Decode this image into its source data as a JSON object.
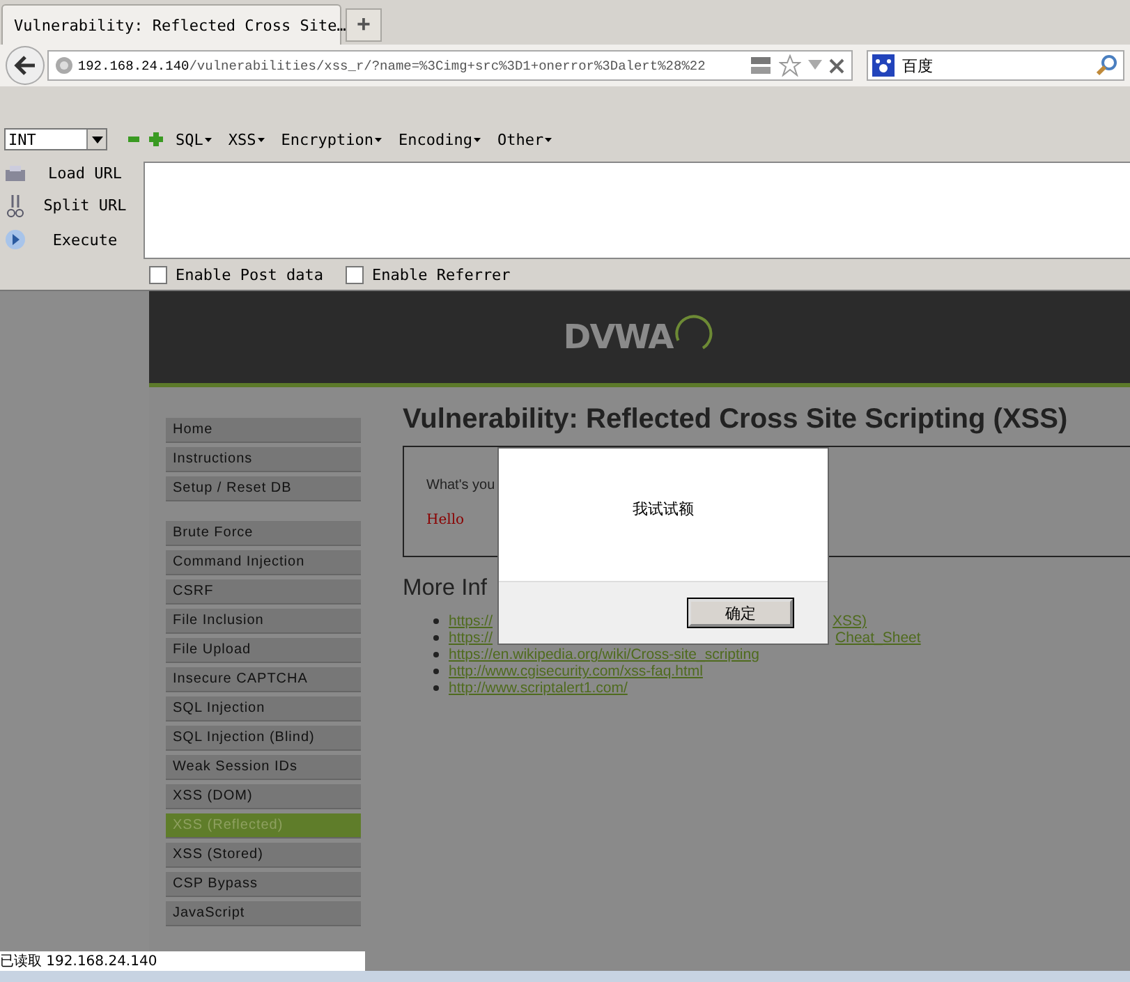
{
  "browser": {
    "tab_title": "Vulnerability: Reflected Cross Site…",
    "new_tab": "+",
    "url_host": "192.168.24.140",
    "url_path": "/vulnerabilities/xss_r/?name=%3Cimg+src%3D1+onerror%3Dalert%28%22",
    "search_engine": "百度"
  },
  "hackbar": {
    "type_select": "INT",
    "menus": [
      "SQL",
      "XSS",
      "Encryption",
      "Encoding",
      "Other"
    ],
    "actions": [
      {
        "kind": "load",
        "label": "Load URL"
      },
      {
        "kind": "split",
        "label": "Split URL"
      },
      {
        "kind": "execute",
        "label": "Execute"
      }
    ],
    "options": [
      {
        "label": "Enable Post data",
        "checked": false
      },
      {
        "label": "Enable Referrer",
        "checked": false
      }
    ]
  },
  "dvwa": {
    "logo": "DVWA",
    "menu_groups": [
      [
        {
          "label": "Home",
          "selected": false
        },
        {
          "label": "Instructions",
          "selected": false
        },
        {
          "label": "Setup / Reset DB",
          "selected": false
        }
      ],
      [
        {
          "label": "Brute Force",
          "selected": false
        },
        {
          "label": "Command Injection",
          "selected": false
        },
        {
          "label": "CSRF",
          "selected": false
        },
        {
          "label": "File Inclusion",
          "selected": false
        },
        {
          "label": "File Upload",
          "selected": false
        },
        {
          "label": "Insecure CAPTCHA",
          "selected": false
        },
        {
          "label": "SQL Injection",
          "selected": false
        },
        {
          "label": "SQL Injection (Blind)",
          "selected": false
        },
        {
          "label": "Weak Session IDs",
          "selected": false
        },
        {
          "label": "XSS (DOM)",
          "selected": false
        },
        {
          "label": "XSS (Reflected)",
          "selected": true
        },
        {
          "label": "XSS (Stored)",
          "selected": false
        },
        {
          "label": "CSP Bypass",
          "selected": false
        },
        {
          "label": "JavaScript",
          "selected": false
        }
      ]
    ],
    "heading": "Vulnerability: Reflected Cross Site Scripting (XSS)",
    "prompt": "What's you",
    "output": "Hello",
    "more_heading": "More Inf",
    "links": [
      {
        "left": "https://",
        "right": "XSS)"
      },
      {
        "left": "https://",
        "right": "Cheat_Sheet"
      },
      {
        "left": "https://en.wikipedia.org/wiki/Cross-site_scripting"
      },
      {
        "left": "http://www.cgisecurity.com/xss-faq.html"
      },
      {
        "left": "http://www.scriptalert1.com/"
      }
    ]
  },
  "alert": {
    "message": "我试试额",
    "button": "确定"
  },
  "status_bar": "已读取 192.168.24.140"
}
